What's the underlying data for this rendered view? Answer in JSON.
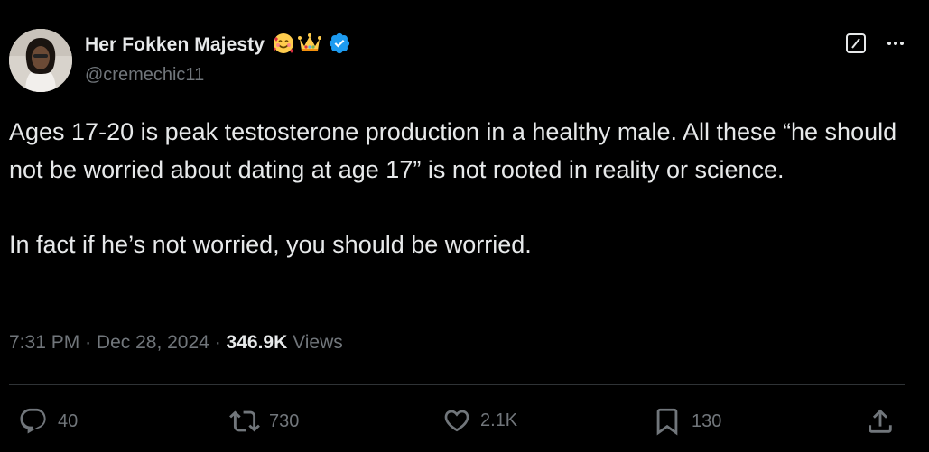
{
  "author": {
    "display_name": "Her Fokken Majesty",
    "handle": "@cremechic11",
    "verified": true,
    "badges": [
      "smiling-face-with-hearts-emoji",
      "crown-emoji"
    ]
  },
  "header": {
    "grok_icon": "grok-icon",
    "more_icon": "more-icon"
  },
  "tweet": {
    "paragraphs": [
      "Ages 17-20 is peak testosterone production in a healthy male.  All these “he should not be worried about dating at age 17” is not rooted in reality or science.",
      "In fact if he’s not worried, you should be worried."
    ]
  },
  "meta": {
    "time": "7:31 PM",
    "separator": "·",
    "date": "Dec 28, 2024",
    "views_count": "346.9K",
    "views_label": "Views"
  },
  "actions": {
    "replies": "40",
    "reposts": "730",
    "likes": "2.1K",
    "bookmarks": "130"
  },
  "colors": {
    "background": "#000000",
    "primary_text": "#e7e9ea",
    "secondary_text": "#71767b",
    "verified_blue": "#1d9bf0",
    "divider": "#2f3336"
  }
}
